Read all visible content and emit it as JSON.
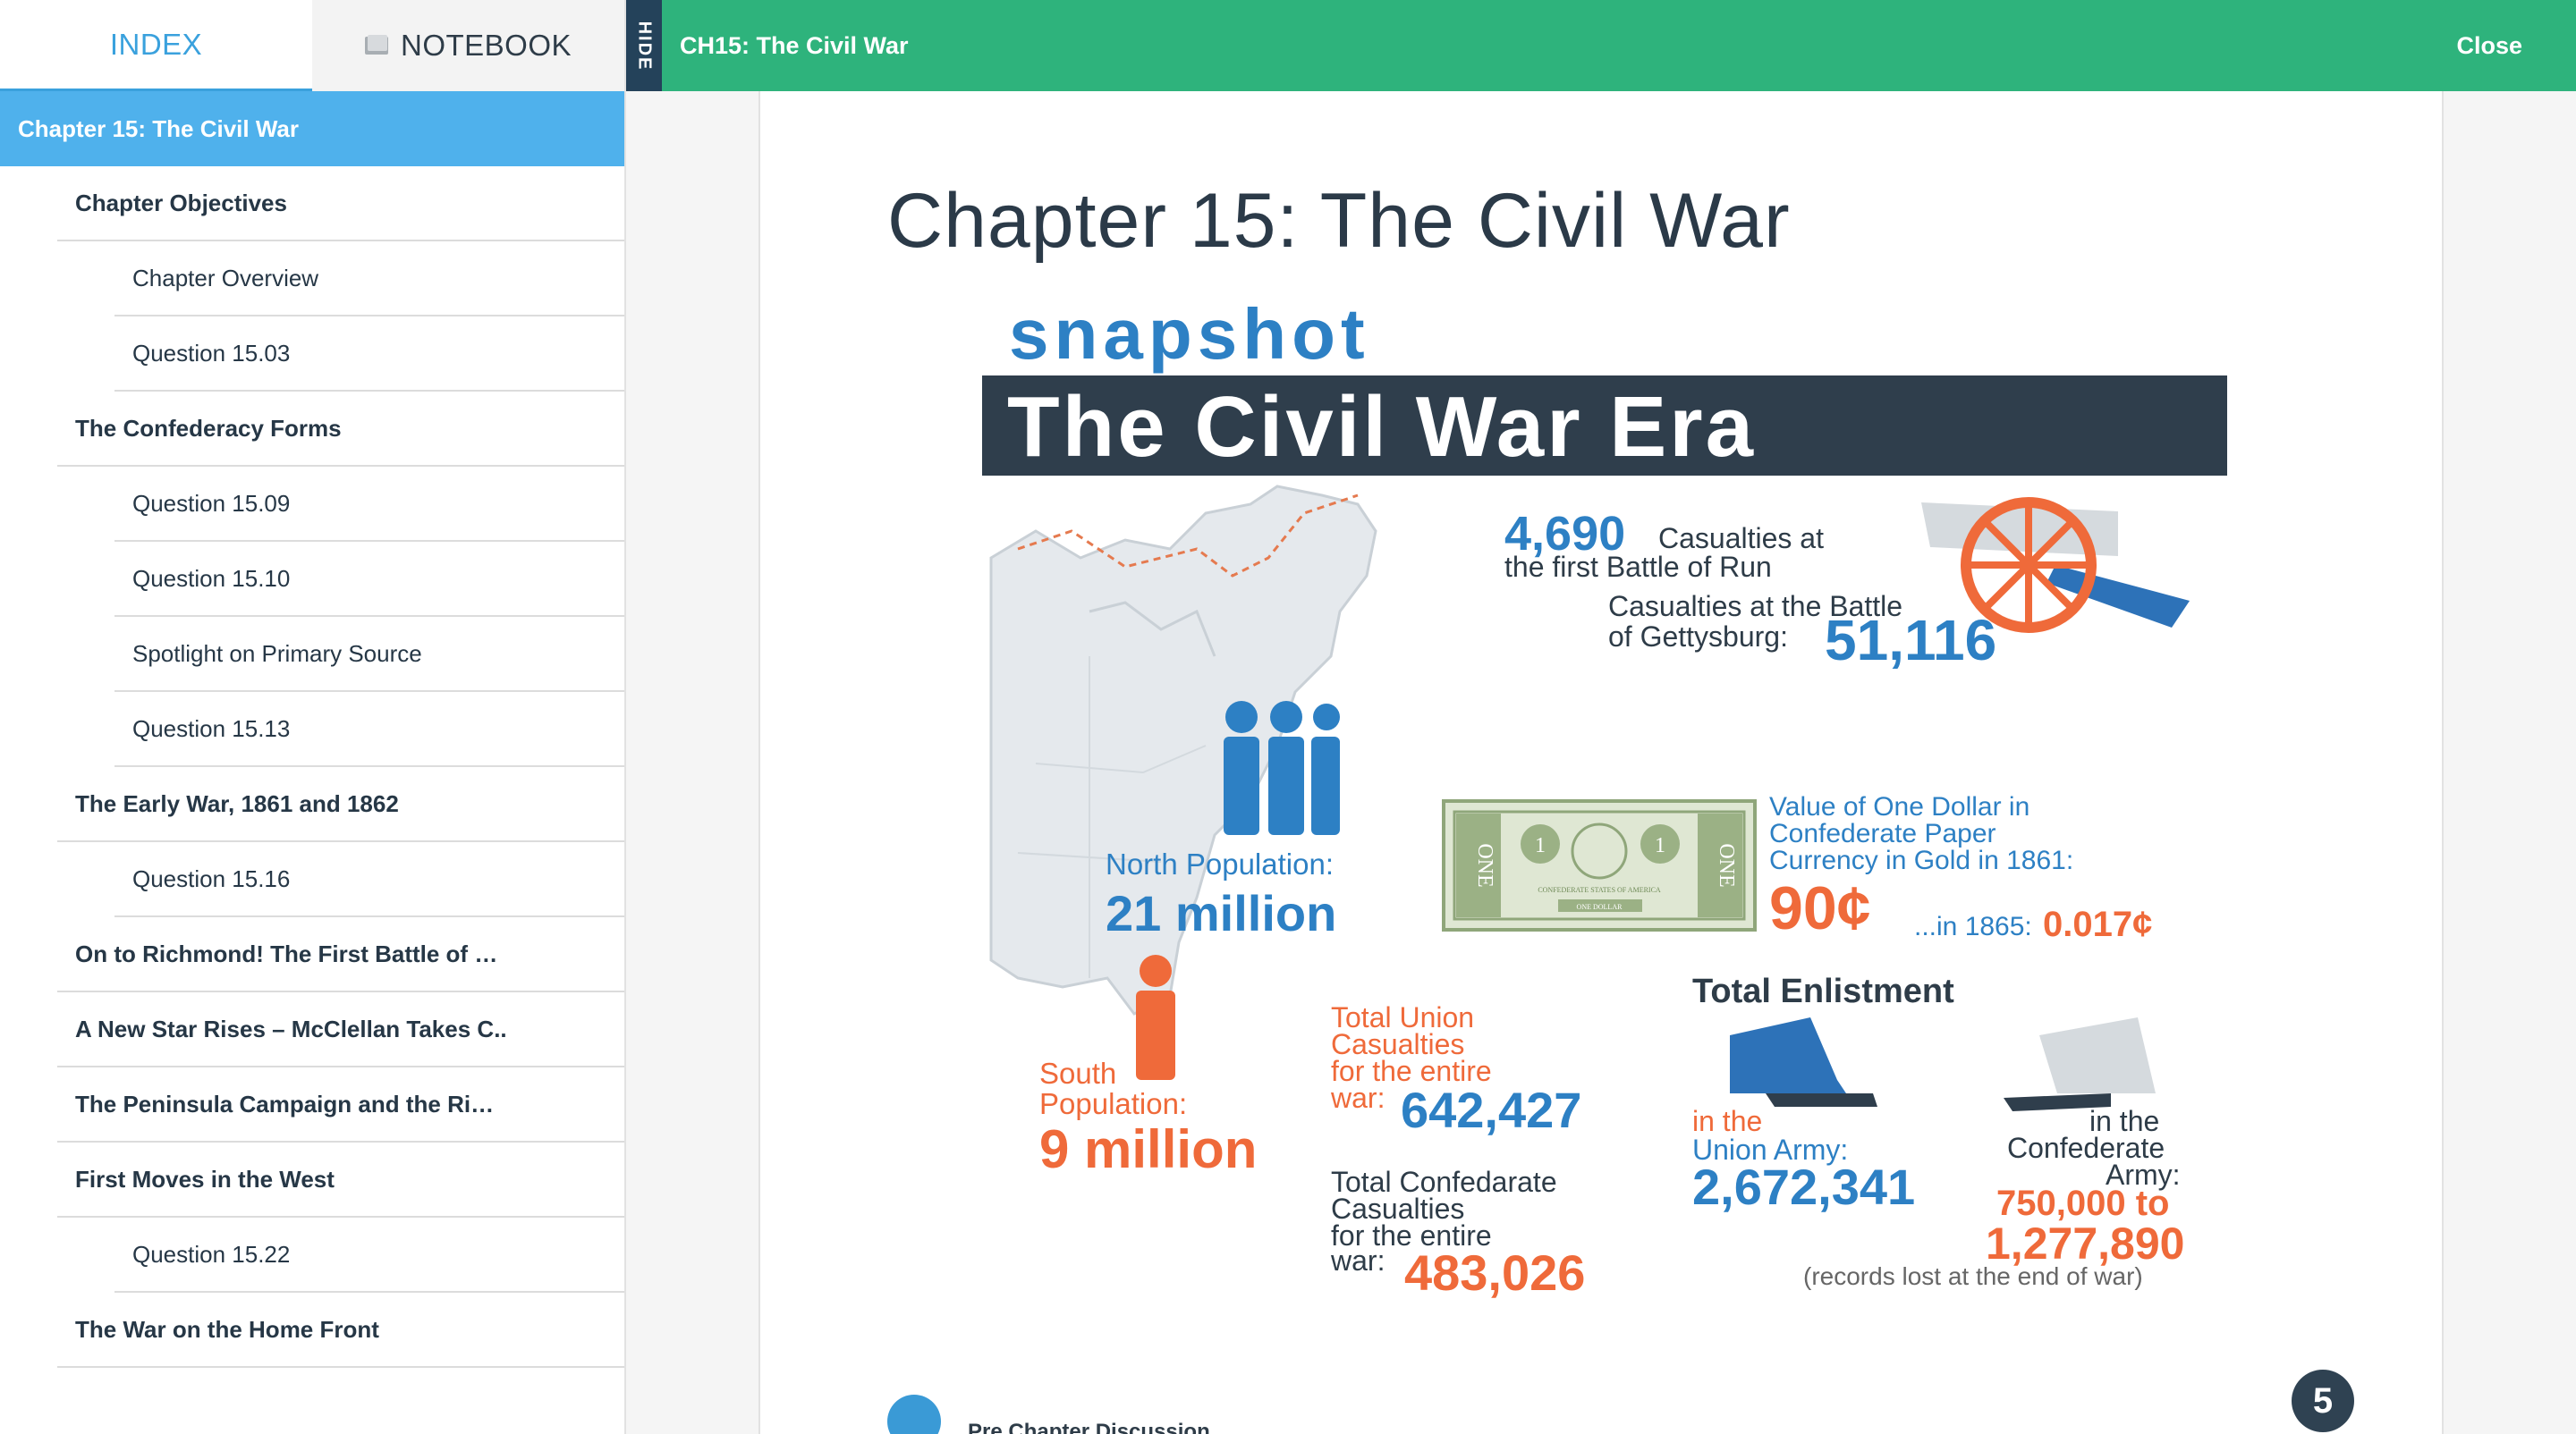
{
  "sidebar": {
    "tabs": {
      "index": "INDEX",
      "notebook": "NOTEBOOK"
    },
    "active_item": "Chapter 15: The Civil War",
    "items": [
      {
        "label": "Chapter Objectives",
        "level": 1
      },
      {
        "label": "Chapter Overview",
        "level": 2
      },
      {
        "label": "Question 15.03",
        "level": 2
      },
      {
        "label": "The Confederacy Forms",
        "level": 1
      },
      {
        "label": "Question 15.09",
        "level": 2
      },
      {
        "label": "Question 15.10",
        "level": 2
      },
      {
        "label": "Spotlight on Primary Source",
        "level": 2
      },
      {
        "label": "Question 15.13",
        "level": 2
      },
      {
        "label": "The Early War, 1861 and 1862",
        "level": 1
      },
      {
        "label": "Question 15.16",
        "level": 2
      },
      {
        "label": "On to Richmond! The First Battle of …",
        "level": 1
      },
      {
        "label": "A New Star Rises – McClellan Takes C..",
        "level": 1
      },
      {
        "label": "The Peninsula Campaign and the Ri…",
        "level": 1
      },
      {
        "label": "First Moves in the West",
        "level": 1
      },
      {
        "label": "Question 15.22",
        "level": 2
      },
      {
        "label": "The War on the Home Front",
        "level": 1
      }
    ]
  },
  "topbar": {
    "hide_label": "HIDE",
    "chapter_crumb": "CH15: The Civil War",
    "close_label": "Close"
  },
  "page": {
    "title": "Chapter 15: The Civil War",
    "page_number": "5",
    "discussion_label": "Pre Chapter Discussion"
  },
  "infographic": {
    "snapshot": "snapshot",
    "title": "The Civil War Era",
    "north_label": "North Population:",
    "north_value": "21 million",
    "south_label_1": "South",
    "south_label_2": "Population:",
    "south_value": "9 million",
    "run_value": "4,690",
    "run_label_1": "Casualties at",
    "run_label_2": "the first Battle of Run",
    "gettysburg_label_1": "Casualties at the Battle",
    "gettysburg_label_2": "of Gettysburg:",
    "gettysburg_value": "51,116",
    "dollar_label_1": "Value of One Dollar in",
    "dollar_label_2": "Confederate Paper",
    "dollar_label_3": "Currency in Gold in 1861:",
    "dollar_1861": "90¢",
    "dollar_1865_label": "...in 1865:",
    "dollar_1865": "0.017¢",
    "bill_text_one": "ONE",
    "bill_number": "1",
    "bill_caption": "CONFEDERATE STATES OF AMERICA",
    "bill_value": "ONE DOLLAR",
    "union_cas_1": "Total Union",
    "union_cas_2": "Casualties",
    "union_cas_3": "for the entire",
    "union_cas_4": "war:",
    "union_cas_value": "642,427",
    "conf_cas_1": "Total Confedarate",
    "conf_cas_2": "Casualties",
    "conf_cas_3": "for the entire",
    "conf_cas_4": "war:",
    "conf_cas_value": "483,026",
    "enlist_title": "Total Enlistment",
    "union_army_1": "in the",
    "union_army_2": "Union Army:",
    "union_army_value": "2,672,341",
    "conf_army_1": "in the",
    "conf_army_2": "Confederate",
    "conf_army_3": "Army:",
    "conf_army_value_1": "750,000 to",
    "conf_army_value_2": "1,277,890",
    "conf_army_note": "(records lost at the end of war)"
  },
  "colors": {
    "topbar": "#2eb37c",
    "active_item": "#4fb1ec",
    "index_tab": "#3aa1dd",
    "infographic_blue": "#2d80c4",
    "infographic_orange": "#ef6a3a",
    "banner": "#2f3e4c"
  }
}
